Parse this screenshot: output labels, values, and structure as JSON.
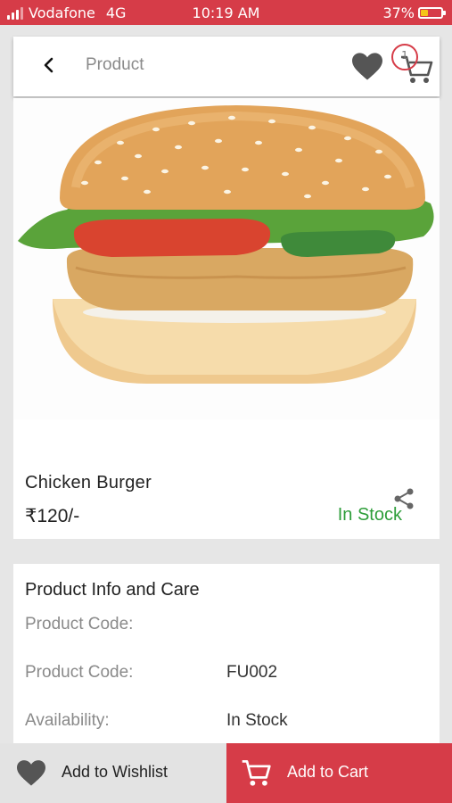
{
  "status_bar": {
    "carrier": "Vodafone",
    "network": "4G",
    "time": "10:19 AM",
    "battery": "37%"
  },
  "header": {
    "title": "Product",
    "cart_count": "1"
  },
  "product": {
    "name": "Chicken Burger",
    "price": "₹120/-",
    "stock_status": "In Stock",
    "image": "chicken-burger-photo"
  },
  "info": {
    "title": "Product Info and Care",
    "rows": [
      {
        "label": "Product Code:",
        "value": ""
      },
      {
        "label": "Product Code:",
        "value": "FU002"
      },
      {
        "label": "Availability:",
        "value": "In Stock"
      }
    ]
  },
  "bottom_bar": {
    "wishlist_label": "Add to Wishlist",
    "cart_label": "Add to Cart"
  },
  "colors": {
    "brand": "#d63c48",
    "in_stock": "#2e9e3a",
    "text_muted": "#8a8a8a"
  },
  "icons": [
    "back-arrow-icon",
    "heart-icon",
    "cart-icon",
    "share-icon"
  ]
}
